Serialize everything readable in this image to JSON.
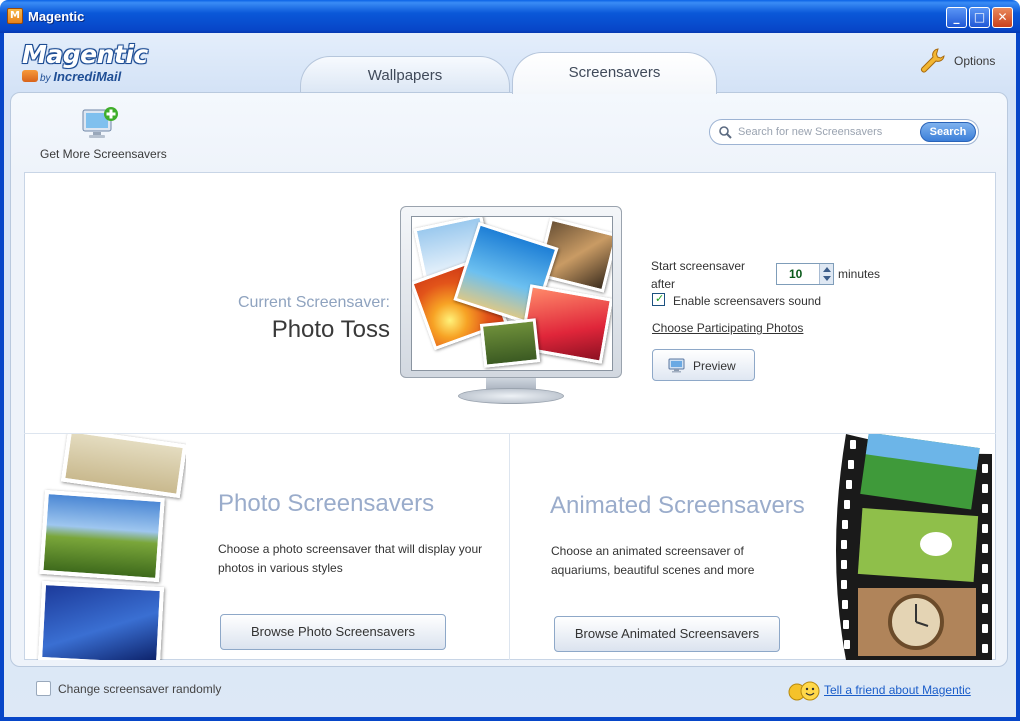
{
  "window": {
    "title": "Magentic",
    "app_icon_letter": "M",
    "controls": {
      "minimize": "_",
      "maximize": "□",
      "close": "✕"
    }
  },
  "header": {
    "logo_brand": "Magentic",
    "logo_by": "by",
    "logo_company": "IncrediMail",
    "tabs": [
      {
        "label": "Wallpapers",
        "active": false
      },
      {
        "label": "Screensavers",
        "active": true
      }
    ],
    "options_label": "Options"
  },
  "toolbar": {
    "get_more_label": "Get More Screensavers",
    "search": {
      "placeholder": "Search for new Screensavers",
      "button_label": "Search"
    }
  },
  "current": {
    "label": "Current Screensaver:",
    "name": "Photo Toss",
    "start_label": "Start screensaver after",
    "minutes_value": "10",
    "minutes_label": "minutes",
    "sound_enabled": true,
    "sound_label": "Enable screensavers sound",
    "choose_photos_link": "Choose Participating Photos",
    "preview_label": "Preview"
  },
  "sections": {
    "photo": {
      "title": "Photo Screensavers",
      "description": "Choose a photo screensaver that will display your photos in various styles",
      "button_label": "Browse Photo Screensavers"
    },
    "animated": {
      "title": "Animated Screensavers",
      "description": "Choose an animated screensaver of aquariums, beautiful scenes and more",
      "button_label": "Browse Animated Screensavers"
    }
  },
  "footer": {
    "random_label": "Change screensaver randomly",
    "random_checked": false,
    "tell_friend_link": "Tell a friend about Magentic"
  },
  "colors": {
    "title_bar": "#0746c8",
    "accent_link": "#1a5dc9",
    "section_title": "#9aaccb",
    "current_label": "#8fa3bf"
  }
}
